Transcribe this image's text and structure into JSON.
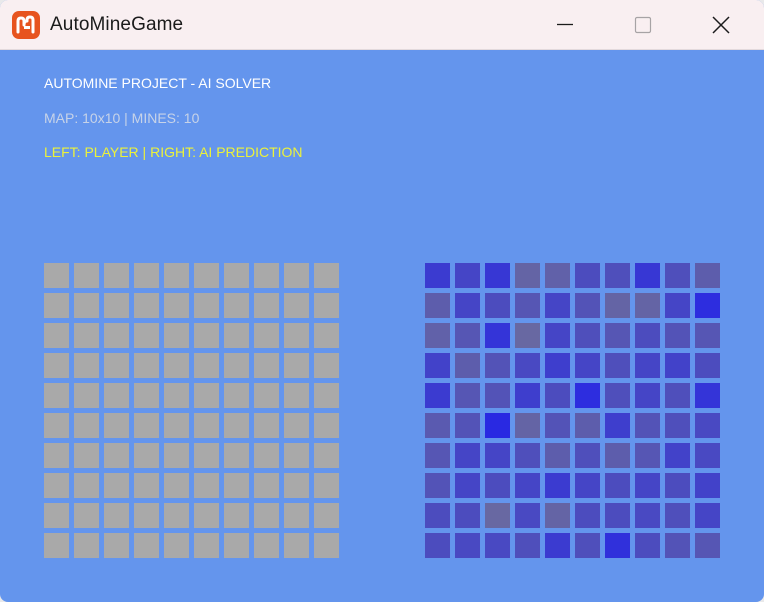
{
  "window": {
    "title": "AutoMineGame",
    "background": "#6495ed",
    "app_icon": "monogame-logo-icon"
  },
  "controls": {
    "minimize_icon": "minimize-icon",
    "maximize_icon": "maximize-icon",
    "close_icon": "close-icon"
  },
  "header": {
    "project_line": "AUTOMINE PROJECT - AI SOLVER",
    "map_line": "MAP: 10x10 | MINES: 10",
    "legend_line": "LEFT: PLAYER | RIGHT: AI PREDICTION",
    "colors": {
      "project": "#ffffff",
      "map": "#c7d3e8",
      "legend": "#ecf23a"
    }
  },
  "map": {
    "rows": 10,
    "cols": 10,
    "mines": 10
  },
  "player_board": {
    "cell_color": "#a9a9a9",
    "state": "all cells unrevealed"
  },
  "ai_board": {
    "probability_scale": "0 = slate #6b6b9e, 1 = bright blue #2626e6",
    "probabilities": [
      [
        0.7,
        0.55,
        0.75,
        0.1,
        0.15,
        0.45,
        0.4,
        0.75,
        0.4,
        0.2
      ],
      [
        0.2,
        0.55,
        0.45,
        0.3,
        0.55,
        0.35,
        0.1,
        0.1,
        0.55,
        0.9
      ],
      [
        0.15,
        0.3,
        0.8,
        0.05,
        0.55,
        0.4,
        0.3,
        0.45,
        0.35,
        0.3
      ],
      [
        0.6,
        0.2,
        0.35,
        0.5,
        0.65,
        0.55,
        0.4,
        0.55,
        0.6,
        0.45
      ],
      [
        0.7,
        0.3,
        0.35,
        0.65,
        0.45,
        0.9,
        0.4,
        0.55,
        0.4,
        0.8
      ],
      [
        0.25,
        0.35,
        0.95,
        0.1,
        0.35,
        0.2,
        0.65,
        0.35,
        0.4,
        0.5
      ],
      [
        0.3,
        0.55,
        0.55,
        0.4,
        0.2,
        0.4,
        0.2,
        0.3,
        0.6,
        0.5
      ],
      [
        0.35,
        0.55,
        0.45,
        0.55,
        0.7,
        0.55,
        0.45,
        0.55,
        0.45,
        0.6
      ],
      [
        0.45,
        0.45,
        0.05,
        0.5,
        0.1,
        0.45,
        0.45,
        0.5,
        0.4,
        0.55
      ],
      [
        0.45,
        0.5,
        0.5,
        0.4,
        0.7,
        0.4,
        0.85,
        0.45,
        0.35,
        0.3
      ]
    ]
  }
}
